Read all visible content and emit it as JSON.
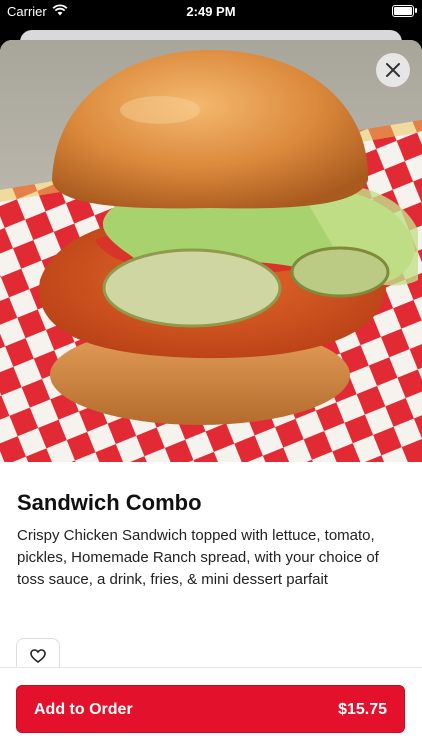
{
  "status_bar": {
    "carrier": "Carrier",
    "time": "2:49 PM"
  },
  "item": {
    "title": "Sandwich Combo",
    "description": "Crispy Chicken Sandwich topped with lettuce, tomato, pickles, Homemade Ranch spread, with your choice of toss sauce, a drink, fries, & mini dessert parfait"
  },
  "actions": {
    "add_label": "Add to Order",
    "price": "$15.75"
  },
  "icons": {
    "close": "close-icon",
    "favorite": "heart-icon",
    "wifi": "wifi-icon",
    "battery": "battery-icon"
  },
  "colors": {
    "accent": "#e3112b"
  }
}
